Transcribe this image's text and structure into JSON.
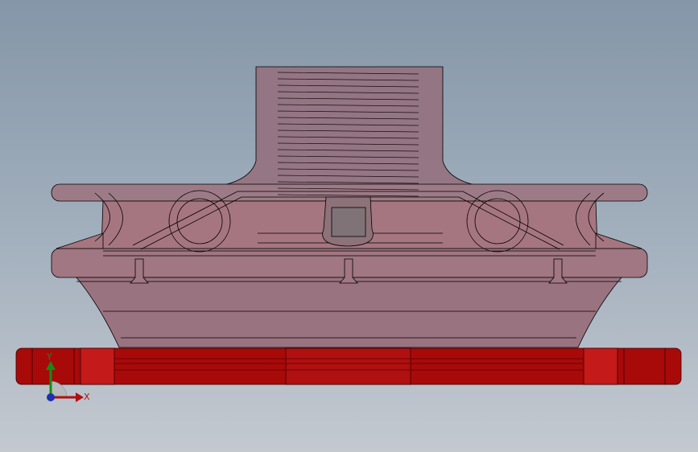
{
  "viewport": {
    "background_top": "#8496a8",
    "background_bottom": "#c4c9d0"
  },
  "model": {
    "body_color": "#a0707e",
    "body_edge_color": "#000000",
    "base_plate_color": "#a80a0a",
    "base_plate_dark": "#7a0606"
  },
  "triad": {
    "x_label": "X",
    "y_label": "Y",
    "x_color": "#b11010",
    "y_color": "#148c14",
    "z_color": "#1e2fb0"
  }
}
